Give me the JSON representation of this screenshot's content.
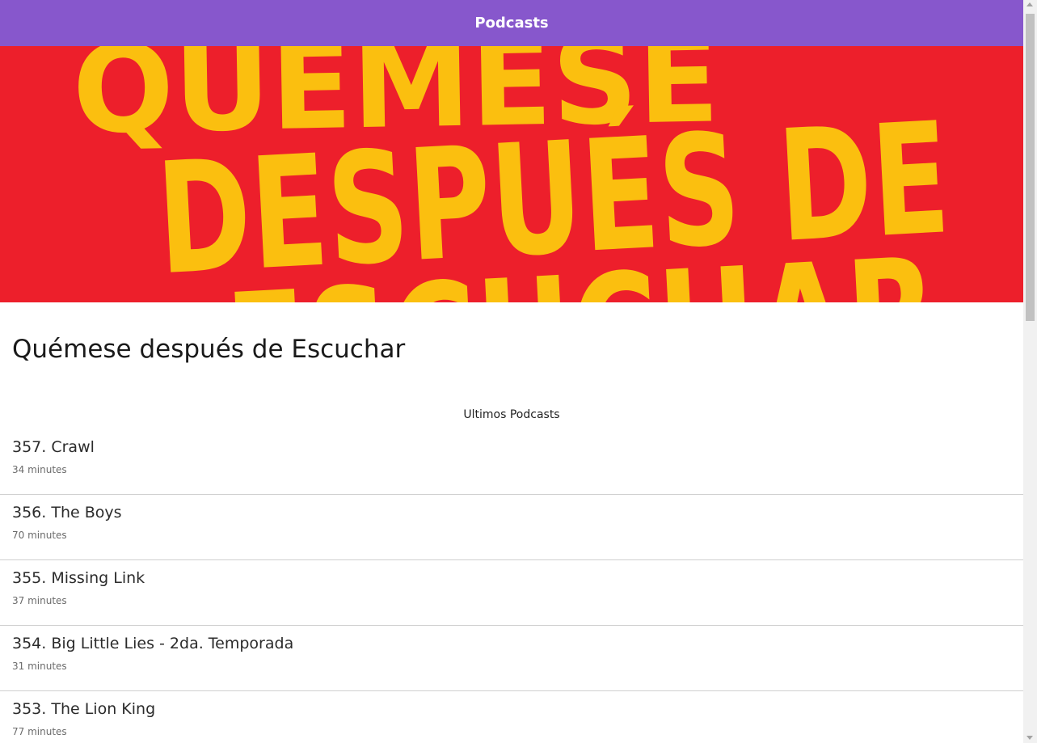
{
  "header": {
    "title": "Podcasts"
  },
  "banner": {
    "artwork_text": "QUÉMESE DESPUÉS DE ESCUCHAR",
    "background_color": "#ed1f2b",
    "text_color": "#fbbf0f"
  },
  "podcast": {
    "title": "Quémese después de Escuchar"
  },
  "section": {
    "label": "Ultimos Podcasts"
  },
  "episodes": [
    {
      "title": "357. Crawl",
      "duration": "34 minutes"
    },
    {
      "title": "356. The Boys",
      "duration": "70 minutes"
    },
    {
      "title": "355. Missing Link",
      "duration": "37 minutes"
    },
    {
      "title": "354. Big Little Lies - 2da. Temporada",
      "duration": "31 minutes"
    },
    {
      "title": "353. The Lion King",
      "duration": "77 minutes"
    }
  ],
  "colors": {
    "header_bg": "#8757cc",
    "divider": "#cfcfcf"
  }
}
